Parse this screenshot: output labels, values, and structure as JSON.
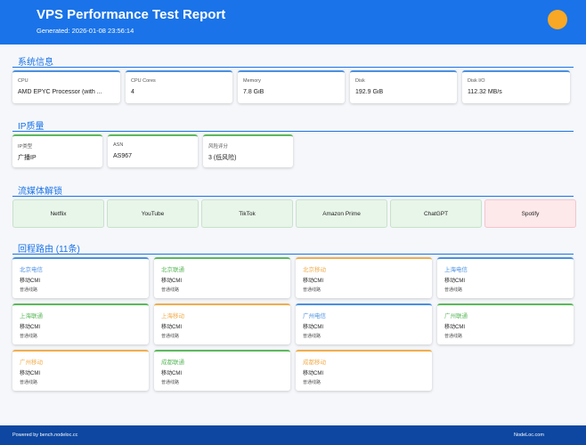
{
  "header": {
    "title": "VPS Performance Test Report",
    "generated": "Generated: 2026-01-08 23:56:14"
  },
  "system": {
    "heading": "系统信息",
    "cards": [
      {
        "label": "CPU",
        "value": "AMD EPYC Processor (with ..."
      },
      {
        "label": "CPU Cores",
        "value": "4"
      },
      {
        "label": "Memory",
        "value": "7.8 GiB"
      },
      {
        "label": "Disk",
        "value": "192.9 GiB"
      },
      {
        "label": "Disk I/O",
        "value": "112.32 MB/s"
      }
    ]
  },
  "ip": {
    "heading": "IP质量",
    "cards": [
      {
        "label": "IP类型",
        "value": "广播IP"
      },
      {
        "label": "ASN",
        "value": "AS967"
      },
      {
        "label": "风险评分",
        "value": "3 (低风险)"
      }
    ]
  },
  "media": {
    "heading": "流媒体解锁",
    "items": [
      {
        "name": "Netflix",
        "status": "unlocked"
      },
      {
        "name": "YouTube",
        "status": "unlocked"
      },
      {
        "name": "TikTok",
        "status": "unlocked"
      },
      {
        "name": "Amazon Prime",
        "status": "unlocked"
      },
      {
        "name": "ChatGPT",
        "status": "unlocked"
      },
      {
        "name": "Spotify",
        "status": "blocked"
      }
    ]
  },
  "routes": {
    "heading": "回程路由 (11条)",
    "items": [
      {
        "name": "北京电信",
        "isp": "移动CMI",
        "type": "普通线路",
        "color": "#4a90e2"
      },
      {
        "name": "北京联通",
        "isp": "移动CMI",
        "type": "普通线路",
        "color": "#5cb85c"
      },
      {
        "name": "北京移动",
        "isp": "移动CMI",
        "type": "普通线路",
        "color": "#f0ad4e"
      },
      {
        "name": "上海电信",
        "isp": "移动CMI",
        "type": "普通线路",
        "color": "#4a90e2"
      },
      {
        "name": "上海联通",
        "isp": "移动CMI",
        "type": "普通线路",
        "color": "#5cb85c"
      },
      {
        "name": "上海移动",
        "isp": "移动CMI",
        "type": "普通线路",
        "color": "#f0ad4e"
      },
      {
        "name": "广州电信",
        "isp": "移动CMI",
        "type": "普通线路",
        "color": "#4a90e2"
      },
      {
        "name": "广州联通",
        "isp": "移动CMI",
        "type": "普通线路",
        "color": "#5cb85c"
      },
      {
        "name": "广州移动",
        "isp": "移动CMI",
        "type": "普通线路",
        "color": "#f0ad4e"
      },
      {
        "name": "成都联通",
        "isp": "移动CMI",
        "type": "普通线路",
        "color": "#5cb85c"
      },
      {
        "name": "成都移动",
        "isp": "移动CMI",
        "type": "普通线路",
        "color": "#f0ad4e"
      }
    ]
  },
  "footer": {
    "left": "Powered by bench.nodeloc.cc",
    "right": "NodeLoc.com"
  },
  "colors": {
    "accent": "#1a73e8",
    "footer": "#0d47a1",
    "telecom": "#4a90e2",
    "unicom": "#5cb85c",
    "mobile": "#f0ad4e",
    "header_badge": "#f9a825"
  }
}
